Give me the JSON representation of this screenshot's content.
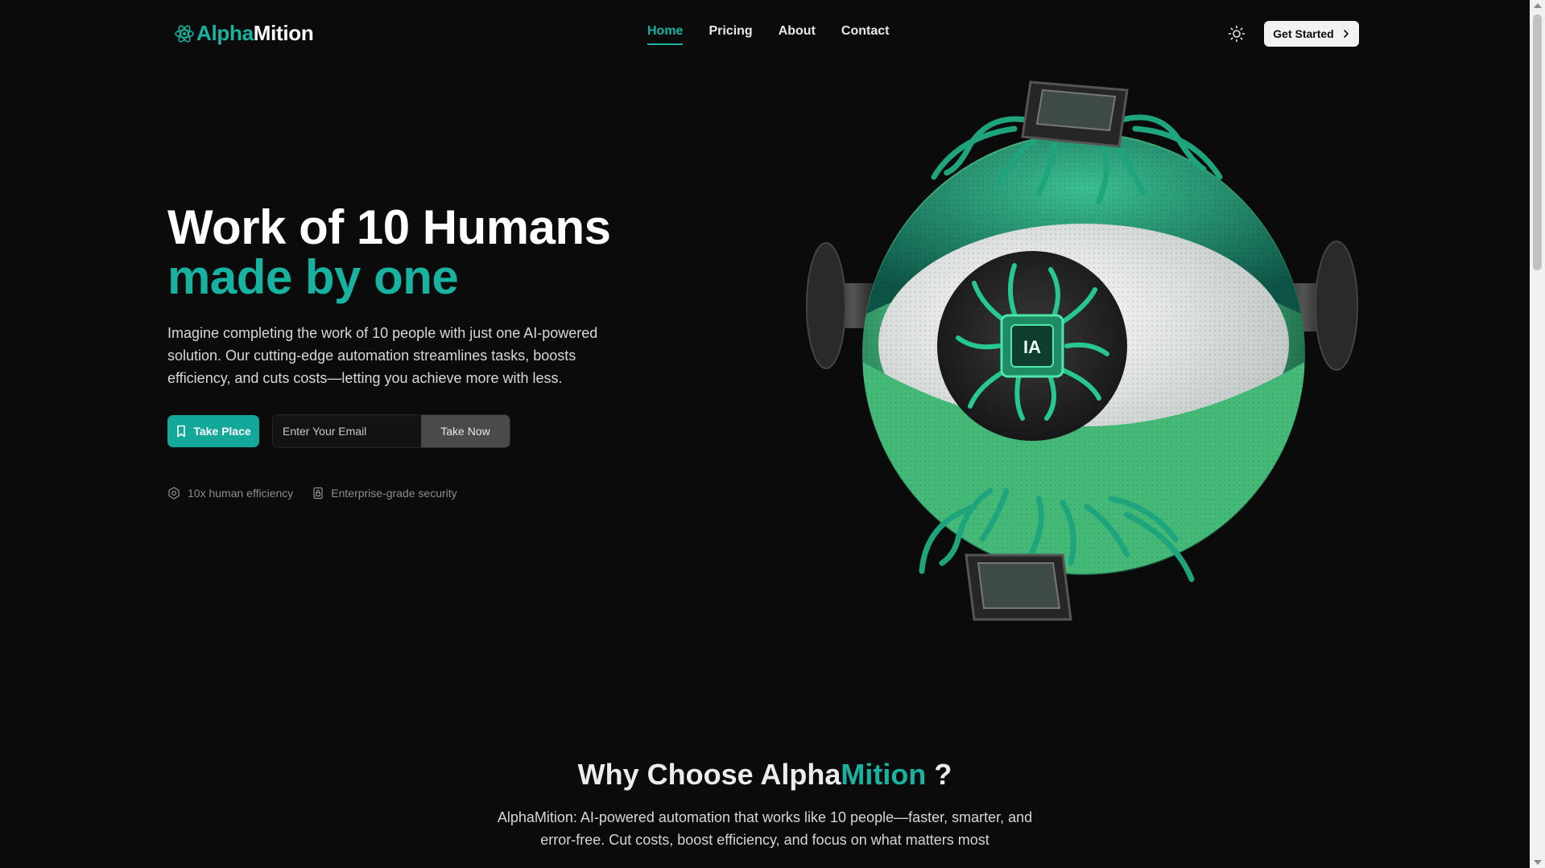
{
  "nav": {
    "logo_accent": "Alpha",
    "logo_rest": "Mition",
    "links": [
      {
        "label": "Home",
        "active": true
      },
      {
        "label": "Pricing",
        "active": false
      },
      {
        "label": "About",
        "active": false
      },
      {
        "label": "Contact",
        "active": false
      }
    ],
    "theme_icon": "sun-icon",
    "cta_label": "Get Started"
  },
  "hero": {
    "title_line1": "Work of 10 Humans",
    "title_line2": "made by one",
    "description": "Imagine completing the work of 10 people with just one AI-powered solution. Our cutting-edge automation streamlines tasks, boosts efficiency, and cuts costs—letting you achieve more with less.",
    "primary_button": "Take Place",
    "email_placeholder": "Enter Your Email",
    "email_button": "Take Now",
    "features": [
      {
        "icon": "hexagon-icon",
        "label": "10x human efficiency"
      },
      {
        "icon": "lock-icon",
        "label": "Enterprise-grade security"
      }
    ],
    "chip_label": "IA"
  },
  "why": {
    "title_pre": "Why Choose Alpha",
    "title_accent": "Mition",
    "title_post": " ?",
    "description": "AlphaMition: AI-powered automation that works like 10 people—faster, smarter, and error-free. Cut costs, boost efficiency, and focus on what matters most"
  },
  "colors": {
    "accent": "#17b3a0",
    "background": "#0b0b0c",
    "button_teal": "#14a89a"
  }
}
